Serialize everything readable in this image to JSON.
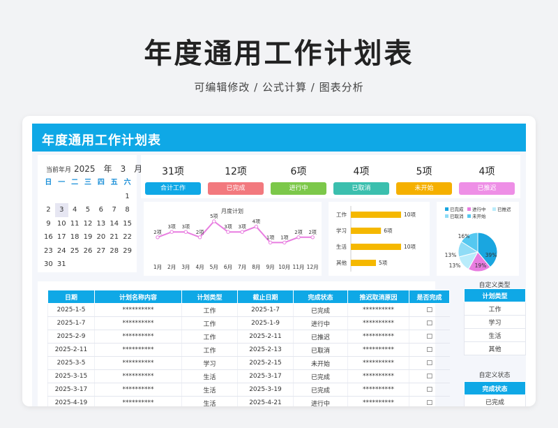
{
  "page": {
    "title": "年度通用工作计划表",
    "subtitle": "可编辑修改 /  公式计算  /  图表分析"
  },
  "sheet": {
    "banner_title": "年度通用工作计划表"
  },
  "calendar": {
    "label": "当前年月",
    "year": "2025",
    "year_unit": "年",
    "month": "3",
    "month_unit": "月",
    "weekdays": [
      "日",
      "一",
      "二",
      "三",
      "四",
      "五",
      "六"
    ],
    "days": [
      "",
      "",
      "",
      "",
      "",
      "",
      "1",
      "2",
      "3",
      "4",
      "5",
      "6",
      "7",
      "8",
      "9",
      "10",
      "11",
      "12",
      "13",
      "14",
      "15",
      "16",
      "17",
      "18",
      "19",
      "20",
      "21",
      "22",
      "23",
      "24",
      "25",
      "26",
      "27",
      "28",
      "29",
      "30",
      "31"
    ],
    "today": "3"
  },
  "stats": [
    {
      "count": "31项",
      "label": "合计工作",
      "color": "#0fa8e6"
    },
    {
      "count": "12项",
      "label": "已完成",
      "color": "#f2797e"
    },
    {
      "count": "6项",
      "label": "进行中",
      "color": "#7cc84a"
    },
    {
      "count": "4项",
      "label": "已取消",
      "color": "#3bbfae"
    },
    {
      "count": "5项",
      "label": "未开始",
      "color": "#f5b000"
    },
    {
      "count": "4项",
      "label": "已推迟",
      "color": "#ee8fe6"
    }
  ],
  "chart_data": [
    {
      "type": "line",
      "title": "月度计划",
      "x": [
        "1月",
        "2月",
        "3月",
        "4月",
        "5月",
        "6月",
        "7月",
        "8月",
        "9月",
        "10月",
        "11月",
        "12月"
      ],
      "values": [
        2,
        3,
        3,
        2,
        5,
        3,
        3,
        4,
        1,
        1,
        2,
        2
      ],
      "value_labels": [
        "2项",
        "3项",
        "3项",
        "2项",
        "5项",
        "3项",
        "3项",
        "4项",
        "1项",
        "1项",
        "2项",
        "2项"
      ],
      "color": "#e87de0"
    },
    {
      "type": "bar",
      "categories": [
        "工作",
        "学习",
        "生活",
        "其他"
      ],
      "values": [
        10,
        6,
        10,
        5
      ],
      "value_labels": [
        "10项",
        "6项",
        "10项",
        "5项"
      ],
      "color": "#f5b800"
    },
    {
      "type": "pie",
      "legend": [
        "已完成",
        "进行中",
        "已推迟",
        "已取消",
        "未开始"
      ],
      "legend_placement": "top",
      "values": [
        39,
        19,
        13,
        13,
        16
      ],
      "value_labels": [
        "39%",
        "19%",
        "13%",
        "13%",
        "16%"
      ],
      "colors": [
        "#1aa6e0",
        "#e87de0",
        "#b9ecfb",
        "#8fdcf6",
        "#55c8f0"
      ]
    }
  ],
  "table": {
    "headers": [
      "日期",
      "计划名称内容",
      "计划类型",
      "截止日期",
      "完成状态",
      "推迟取消原因",
      "是否完成"
    ],
    "rows": [
      [
        "2025-1-5",
        "**********",
        "工作",
        "2025-1-7",
        "已完成",
        "**********",
        "□"
      ],
      [
        "2025-1-7",
        "**********",
        "工作",
        "2025-1-9",
        "进行中",
        "**********",
        "□"
      ],
      [
        "2025-2-9",
        "**********",
        "工作",
        "2025-2-11",
        "已推迟",
        "**********",
        "□"
      ],
      [
        "2025-2-11",
        "**********",
        "工作",
        "2025-2-13",
        "已取消",
        "**********",
        "□"
      ],
      [
        "2025-3-5",
        "**********",
        "学习",
        "2025-2-15",
        "未开始",
        "**********",
        "□"
      ],
      [
        "2025-3-15",
        "**********",
        "生活",
        "2025-3-17",
        "已完成",
        "**********",
        "□"
      ],
      [
        "2025-3-17",
        "**********",
        "生活",
        "2025-3-19",
        "已完成",
        "**********",
        "□"
      ],
      [
        "2025-4-19",
        "**********",
        "生活",
        "2025-4-21",
        "进行中",
        "**********",
        "□"
      ]
    ]
  },
  "custom_type": {
    "label": "自定义类型",
    "header": "计划类型",
    "items": [
      "工作",
      "学习",
      "生活",
      "其他"
    ]
  },
  "custom_status": {
    "label": "自定义状态",
    "header": "完成状态",
    "items": [
      "已完成"
    ]
  }
}
